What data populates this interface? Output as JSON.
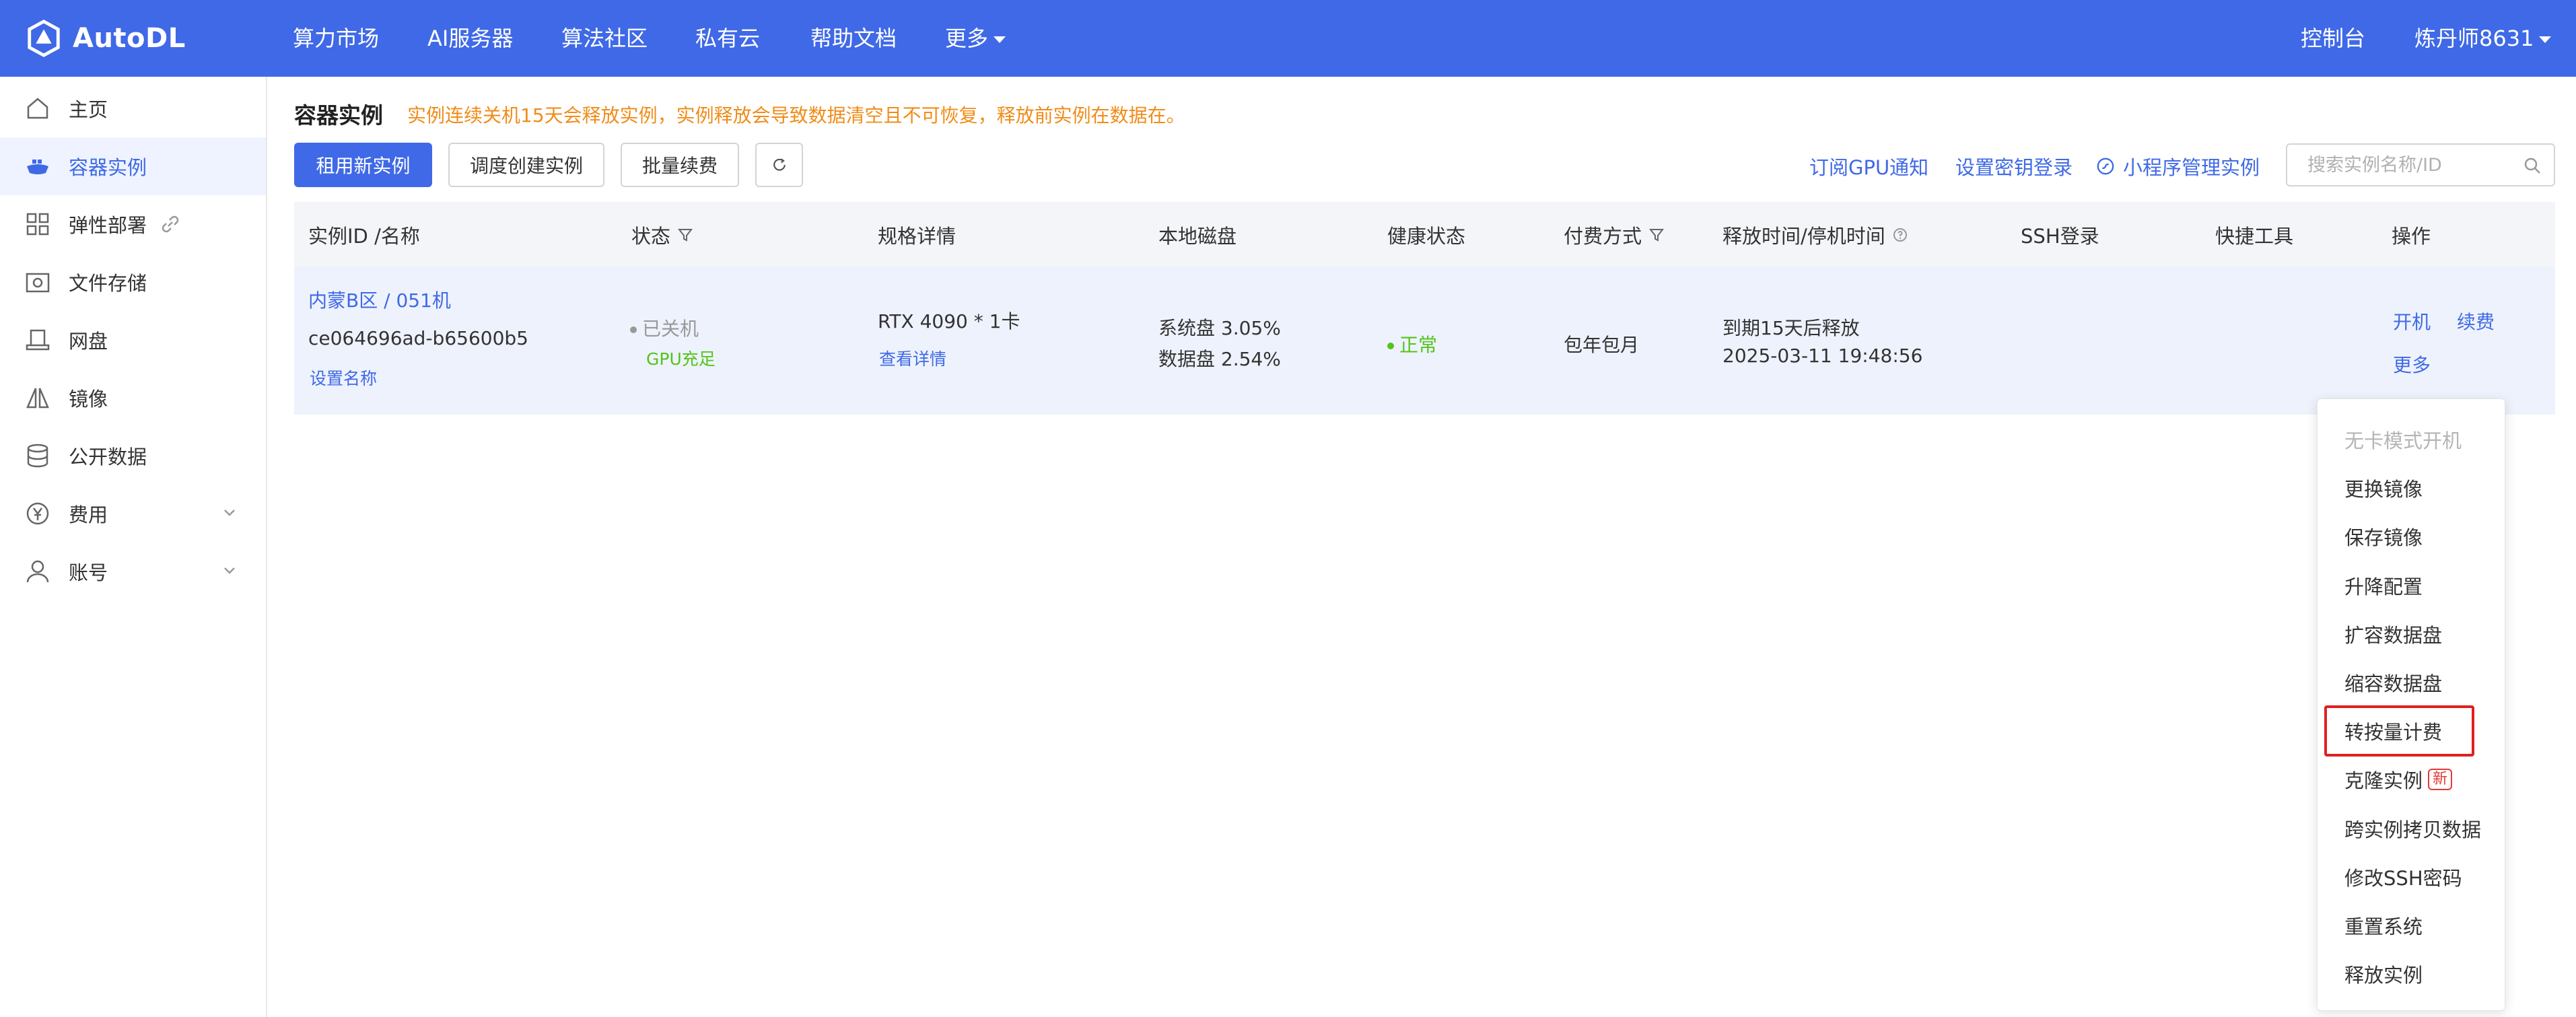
{
  "brand": {
    "name": "AutoDL"
  },
  "nav": {
    "items": [
      "算力市场",
      "AI服务器",
      "算法社区",
      "私有云",
      "帮助文档",
      "更多"
    ],
    "console": "控制台",
    "user": "炼丹师8631"
  },
  "sidebar": {
    "items": [
      {
        "label": "主页",
        "icon": "home-icon"
      },
      {
        "label": "容器实例",
        "icon": "container-icon",
        "active": true
      },
      {
        "label": "弹性部署",
        "icon": "grid-icon"
      },
      {
        "label": "文件存储",
        "icon": "storage-icon"
      },
      {
        "label": "网盘",
        "icon": "cloud-disk-icon"
      },
      {
        "label": "镜像",
        "icon": "mirror-icon"
      },
      {
        "label": "公开数据",
        "icon": "database-icon"
      },
      {
        "label": "费用",
        "icon": "yen-icon"
      },
      {
        "label": "账号",
        "icon": "user-icon"
      }
    ]
  },
  "page": {
    "title": "容器实例",
    "warning": "实例连续关机15天会释放实例，实例释放会导致数据清空且不可恢复，释放前实例在数据在。"
  },
  "toolbar": {
    "rent_new": "租用新实例",
    "schedule_create": "调度创建实例",
    "batch_renew": "批量续费",
    "subscribe_gpu": "订阅GPU通知",
    "set_key_login": "设置密钥登录",
    "mini_program": "小程序管理实例",
    "search_placeholder": "搜索实例名称/ID"
  },
  "table": {
    "headers": [
      "实例ID /名称",
      "状态",
      "规格详情",
      "本地磁盘",
      "健康状态",
      "付费方式",
      "释放时间/停机时间",
      "SSH登录",
      "快捷工具",
      "操作"
    ],
    "row": {
      "name": "内蒙B区 / 051机",
      "id": "ce064696ad-b65600b5",
      "set_name": "设置名称",
      "status": "已关机",
      "gpu_status": "GPU充足",
      "spec": "RTX 4090 * 1卡",
      "spec_detail": "查看详情",
      "disk_system": "系统盘 3.05%",
      "disk_data": "数据盘 2.54%",
      "health": "正常",
      "billing": "包年包月",
      "release": "到期15天后释放",
      "release_time": "2025-03-11 19:48:56",
      "action_start": "开机",
      "action_renew": "续费",
      "action_more": "更多"
    }
  },
  "dropdown": {
    "items": [
      "无卡模式开机",
      "更换镜像",
      "保存镜像",
      "升降配置",
      "扩容数据盘",
      "缩容数据盘",
      "转按量计费",
      "克隆实例",
      "跨实例拷贝数据",
      "修改SSH密码",
      "重置系统",
      "释放实例"
    ],
    "new_badge": "新"
  },
  "colors": {
    "primary": "#3f69e6",
    "warning": "#f08c1a",
    "success": "#52c41a",
    "highlight": "#e02020"
  }
}
